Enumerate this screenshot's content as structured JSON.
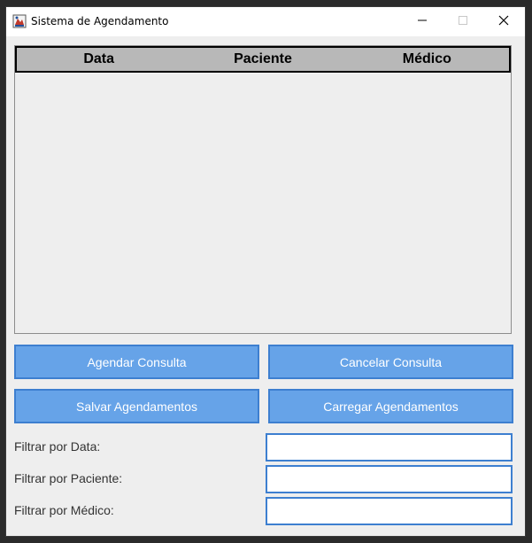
{
  "window": {
    "title": "Sistema de Agendamento"
  },
  "table": {
    "columns": [
      "Data",
      "Paciente",
      "Médico"
    ],
    "rows": []
  },
  "buttons": {
    "schedule": "Agendar Consulta",
    "cancel": "Cancelar Consulta",
    "save": "Salvar Agendamentos",
    "load": "Carregar Agendamentos"
  },
  "filters": {
    "date_label": "Filtrar por Data:",
    "date_value": "",
    "patient_label": "Filtrar por Paciente:",
    "patient_value": "",
    "doctor_label": "Filtrar por Médico:",
    "doctor_value": ""
  },
  "colors": {
    "button_fill": "#66a3e8",
    "button_border": "#3d7fd0",
    "header_fill": "#b8b8b8"
  }
}
